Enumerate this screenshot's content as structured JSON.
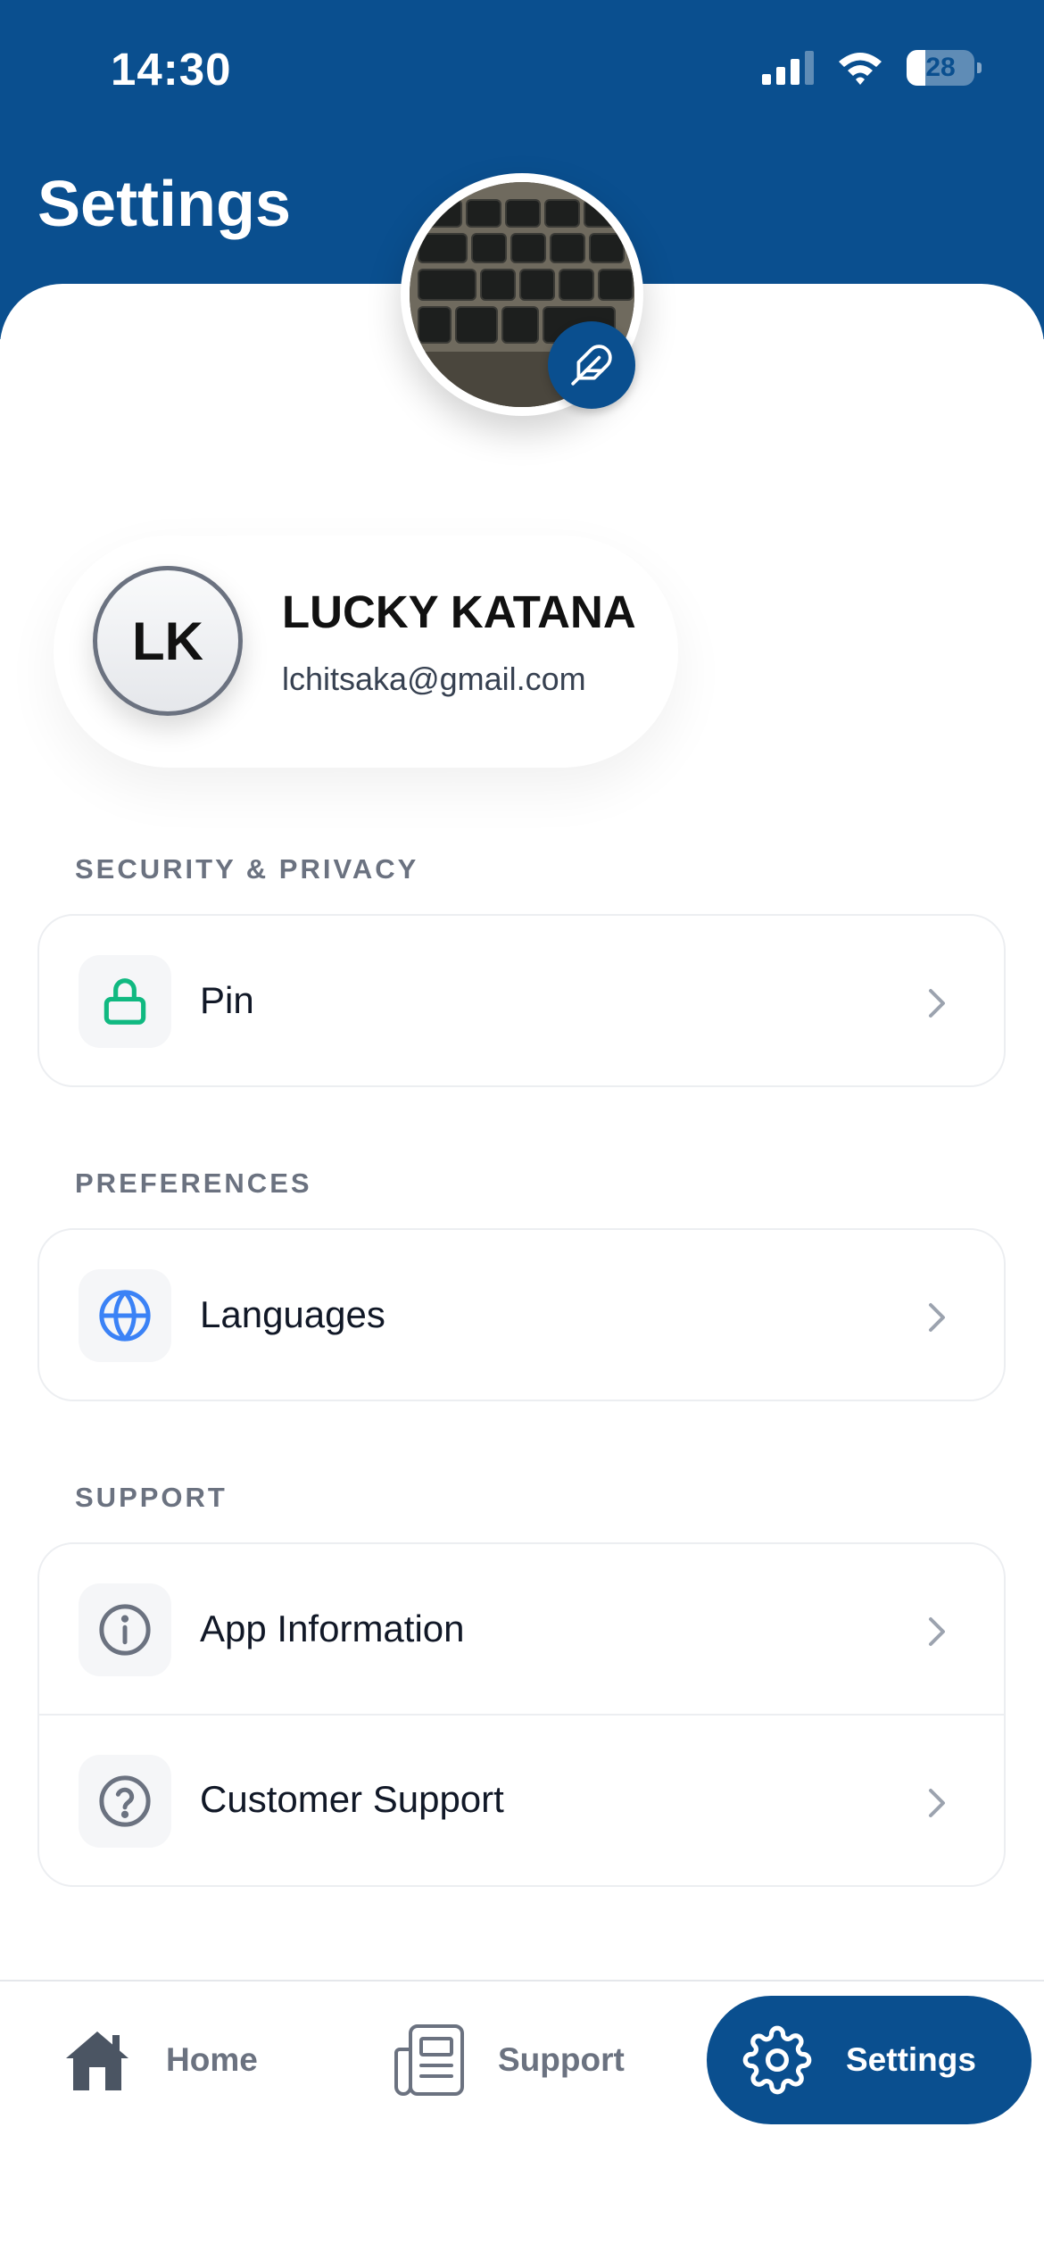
{
  "status_bar": {
    "time": "14:30",
    "battery": "28",
    "battery_level": 0.28
  },
  "header": {
    "title": "Settings",
    "background_color": "#0a4f8f"
  },
  "profile": {
    "initials": "LK",
    "name": "LUCKY KATANA",
    "email": "lchitsaka@gmail.com",
    "photo_icon": "keyboard-photo",
    "edit_icon": "feather-pen-icon"
  },
  "sections": [
    {
      "title": "SECURITY & PRIVACY",
      "items": [
        {
          "label": "Pin",
          "icon": "lock-icon",
          "icon_color": "#10b981"
        }
      ]
    },
    {
      "title": "PREFERENCES",
      "items": [
        {
          "label": "Languages",
          "icon": "globe-icon",
          "icon_color": "#3b82f6"
        }
      ]
    },
    {
      "title": "SUPPORT",
      "items": [
        {
          "label": "App Information",
          "icon": "info-icon",
          "icon_color": "#6b7280"
        },
        {
          "label": "Customer Support",
          "icon": "help-icon",
          "icon_color": "#6b7280"
        }
      ]
    }
  ],
  "bottom_nav": {
    "items": [
      {
        "label": "Home",
        "icon": "home-icon",
        "active": false
      },
      {
        "label": "Support",
        "icon": "newspaper-icon",
        "active": false
      },
      {
        "label": "Settings",
        "icon": "gear-icon",
        "active": true
      }
    ],
    "active_color": "#0a4f8f"
  }
}
